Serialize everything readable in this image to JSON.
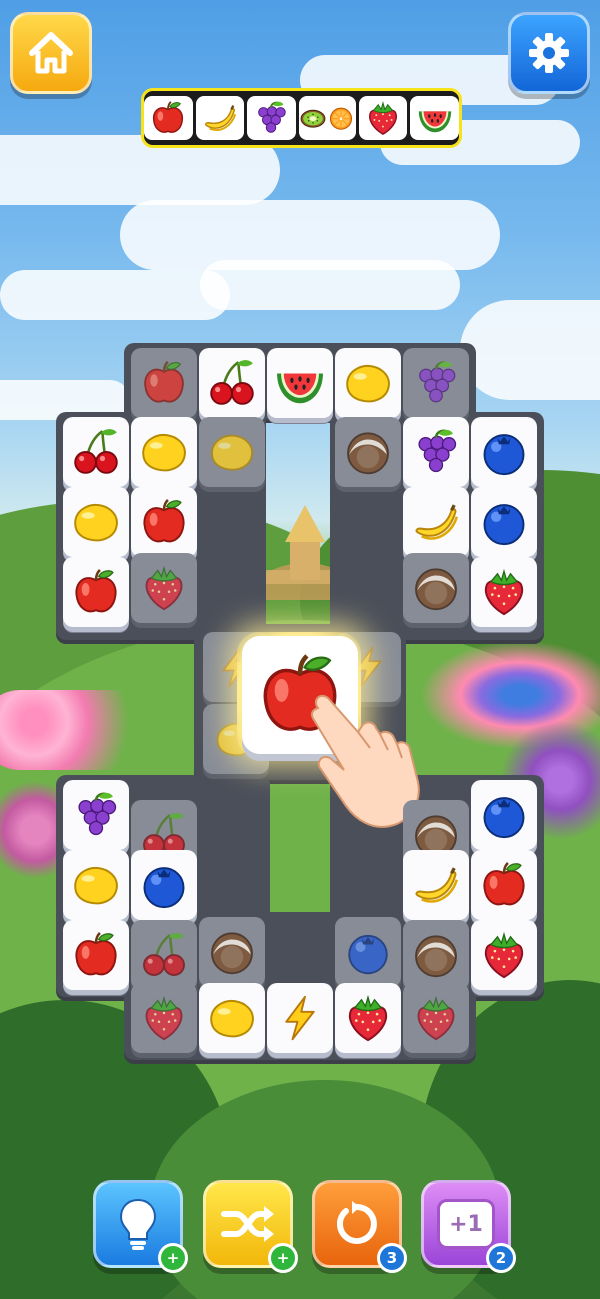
{
  "header": {
    "home_icon": "home-icon",
    "settings_icon": "gear-icon"
  },
  "tray": {
    "slots": [
      "apple",
      "banana",
      "grape",
      "kiwi",
      "orange",
      "strawberry",
      "watermelon"
    ]
  },
  "board": {
    "selected_tile": "apple"
  },
  "boosters": {
    "hint": {
      "icon": "lightbulb-icon",
      "badge": "+"
    },
    "shuffle": {
      "icon": "shuffle-icon",
      "badge": "+"
    },
    "undo": {
      "icon": "undo-icon",
      "badge": "3"
    },
    "extra_slot": {
      "label": "+1",
      "badge": "2"
    }
  },
  "colors": {
    "home_button": "#f6a90f",
    "settings_button": "#1266d8",
    "tray_border": "#f7e31a",
    "tile_face": "#fbfbfd",
    "board_bg": "#4b4f5a"
  }
}
